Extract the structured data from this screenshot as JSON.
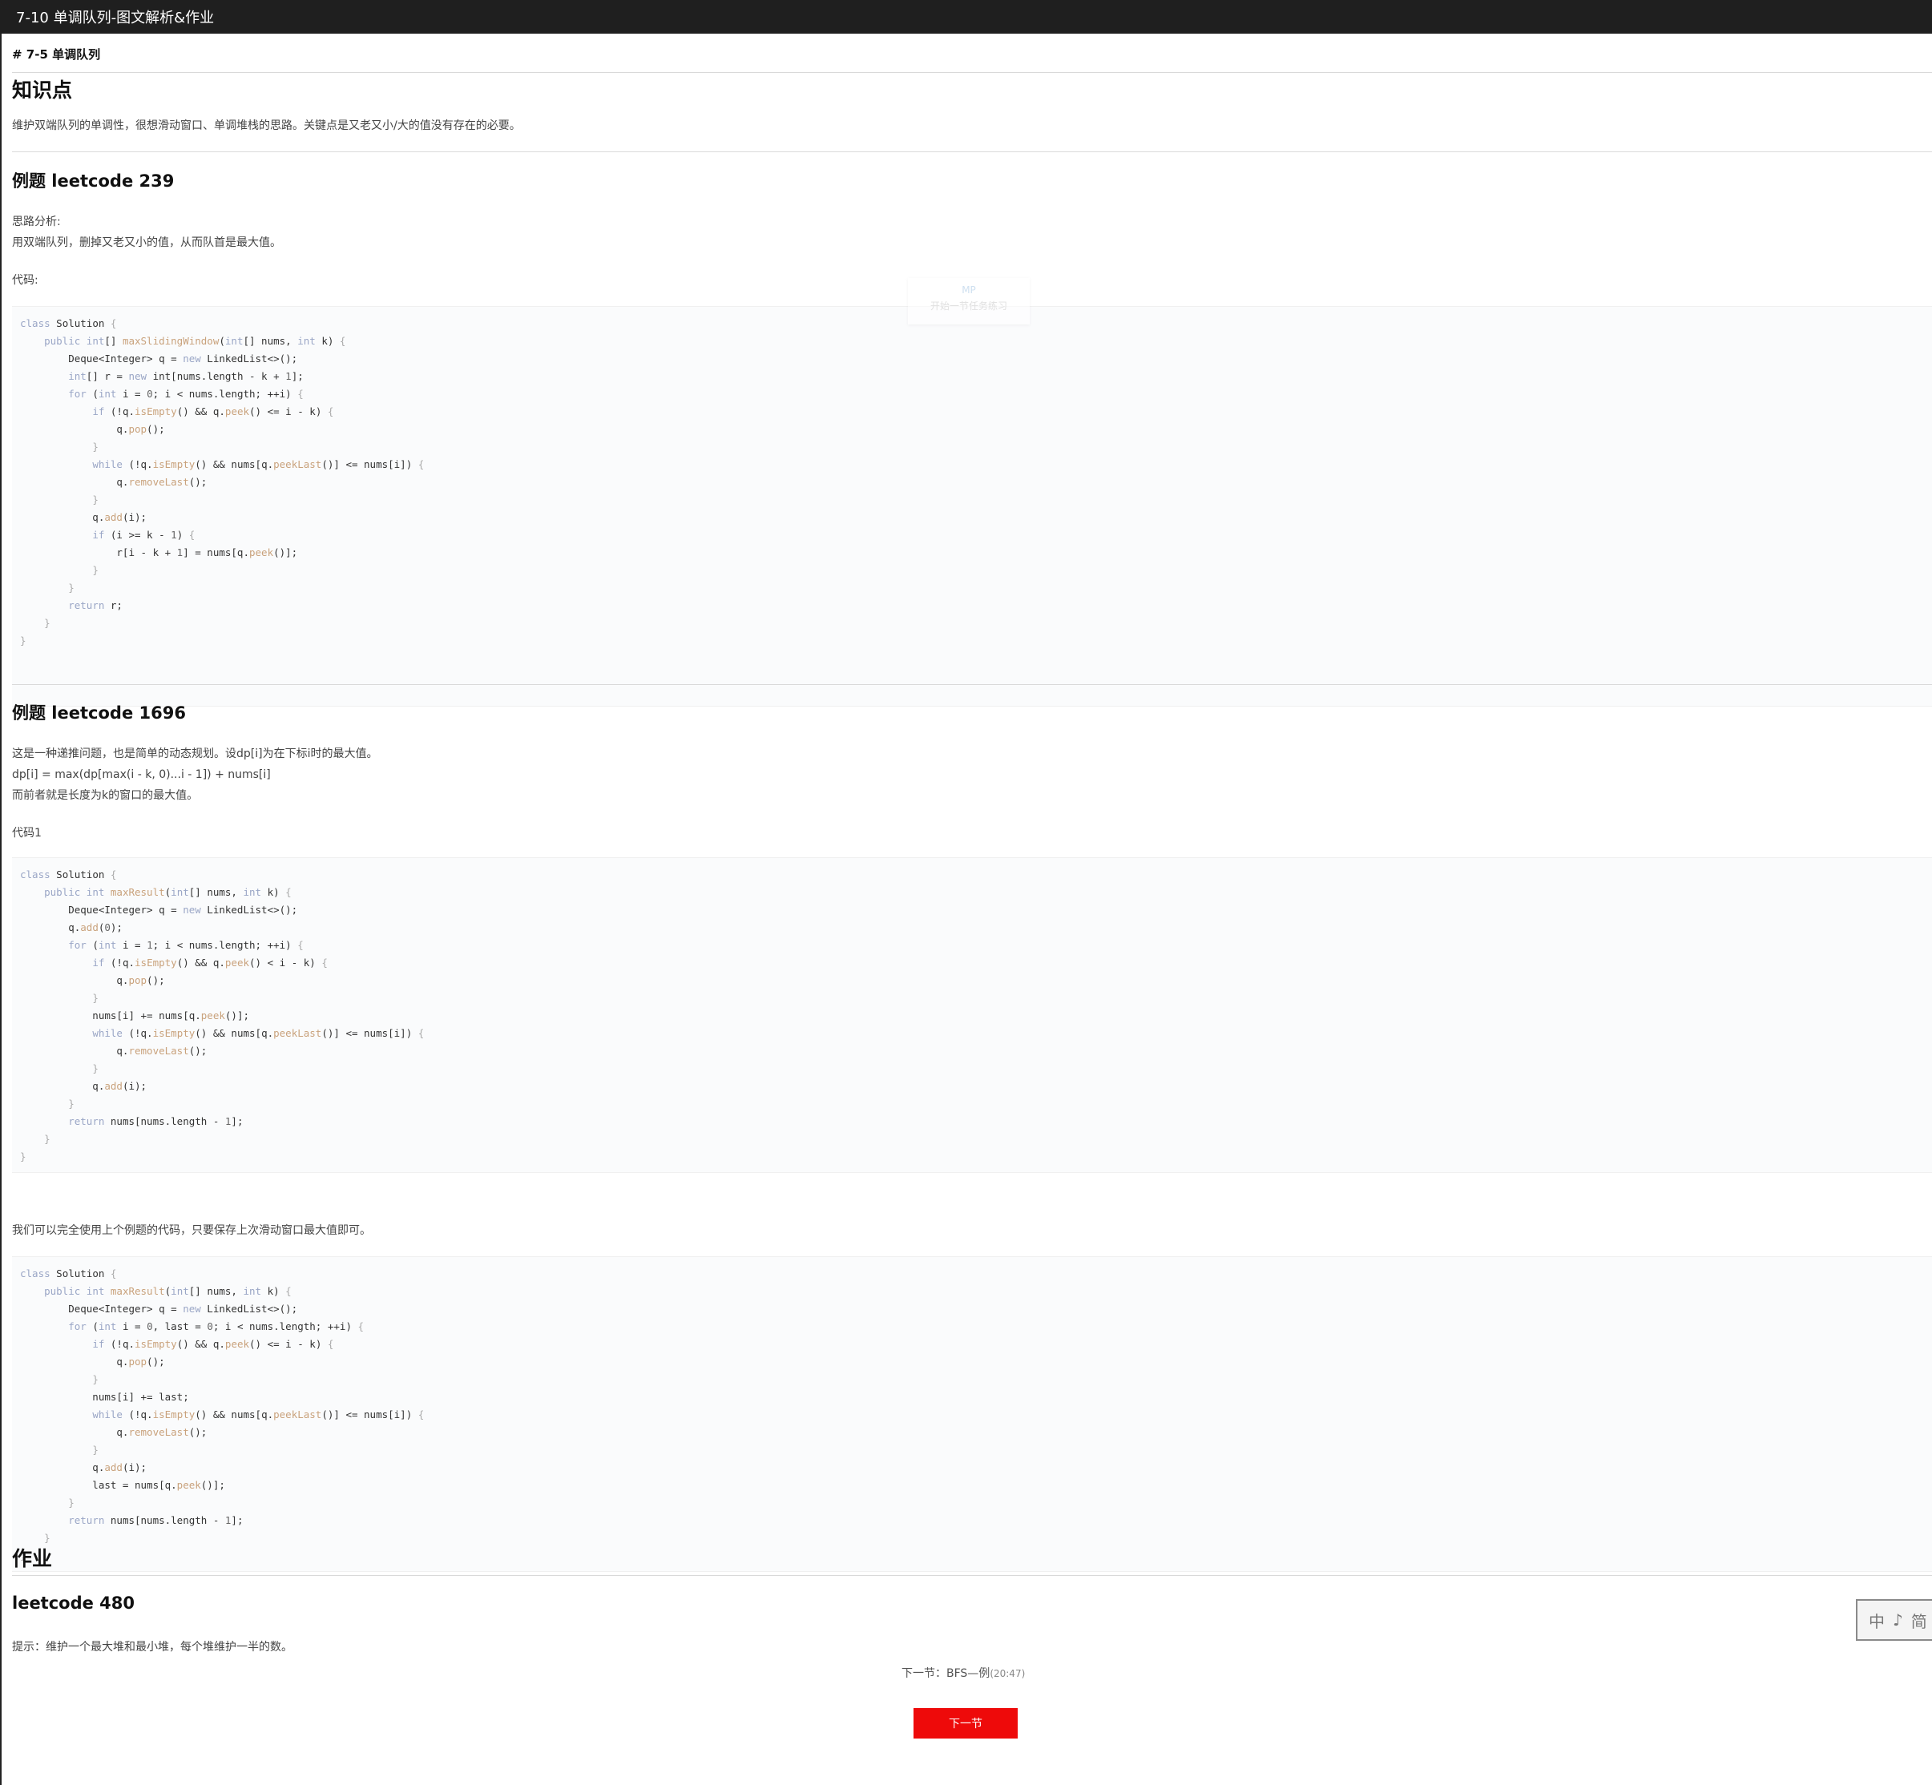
{
  "window": {
    "title": "7-10 单调队列-图文解析&作业"
  },
  "doc_heading": "# 7-5 单调队列",
  "section_knowledge": {
    "title": "知识点",
    "text": "维护双端队列的单调性，很想滑动窗口、单调堆栈的思路。关键点是又老又小/大的值没有存在的必要。"
  },
  "example1": {
    "title": "例题 leetcode 239",
    "analysis_label": "思路分析:",
    "analysis_text": "用双端队列，删掉又老又小的值，从而队首是最大值。",
    "code_label": "代码:"
  },
  "overlay": {
    "line1": "MP",
    "line2": "开始一节任务练习"
  },
  "example2": {
    "title": "例题 leetcode 1696",
    "line1": "这是一种递推问题，也是简单的动态规划。设dp[i]为在下标i时的最大值。",
    "line2": "dp[i] = max(dp[max(i - k, 0)...i - 1]) + nums[i]",
    "line3": "而前者就是长度为k的窗口的最大值。",
    "code_label": "代码1",
    "between_text": "我们可以完全使用上个例题的代码，只要保存上次滑动窗口最大值即可。"
  },
  "homework": {
    "title": "作业",
    "subtitle": "leetcode 480",
    "hint": "提示：维护一个最大堆和最小堆，每个堆维护一半的数。"
  },
  "next": {
    "prefix": "下一节：BFS—例",
    "duration": "(20:47)",
    "button_label": "下一节"
  },
  "stamp": {
    "chars": [
      "中",
      "♪",
      "简"
    ]
  }
}
